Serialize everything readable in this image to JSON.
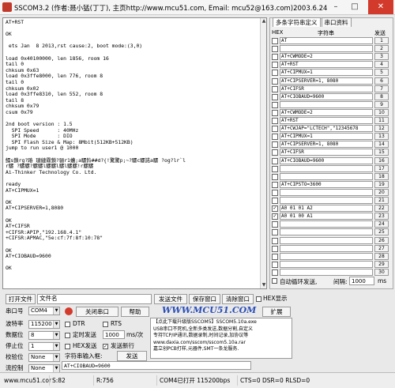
{
  "window": {
    "title": "SSCOM3.2 (作者:聂小猛(丁丁), 主页http://www.mcu51.com, Email: mcu52@163.com)2003.6.24",
    "min": "–",
    "max": "□",
    "close": "✕"
  },
  "log": {
    "lines": [
      "AT+RST",
      "",
      "OK",
      "",
      " ets Jan  8 2013,rst cause:2, boot mode:(3,0)",
      "",
      "load 0x40100000, len 1856, room 16",
      "tail 0",
      "chksum 0x63",
      "load 0x3ffe8000, len 776, room 8",
      "tail 0",
      "chksum 0x02",
      "load 0x3ffe8310, len 552, room 8",
      "tail 8",
      "chksum 0x79",
      "csum 0x79",
      "",
      "2nd boot version : 1.5",
      "  SPI Speed      : 40MHz",
      "  SPI Mode       : DIO",
      "  SPI Flash Size & Map: 8Mbit(512KB+512KB)",
      "jump to run user1 @ 1000",
      "",
      "鳎s鎖rg?蹖 璉縺霧鎖?骊r1螬;a騾鈴##d?{!驚驚p;~?騾c騾諾a騾 ?og?lr`l",
      "r騾 ?騾騾?騾騾l騾騾l騾l騾騾!r騾騾",
      "Ai-Thinker Technology Co. Ltd.",
      "",
      "ready",
      "AT+CIPMUX=1",
      "",
      "OK",
      "AT+CIPSERVER=1,8080",
      "",
      "OK",
      "AT+CIFSR",
      "+CIFSR:APIP,\"192.168.4.1\"",
      "+CIFSR:APMAC,\"5e:cf:7f:8f:10:78\"",
      "",
      "OK",
      "AT+CIOBAUD=9600",
      "",
      "OK"
    ]
  },
  "tabs": [
    "多条字符串定义",
    "串口资料"
  ],
  "multi_header": {
    "hex": "HEX",
    "str": "字符串",
    "send": "发送"
  },
  "multi_rows": [
    {
      "text": "AT",
      "n": "1"
    },
    {
      "text": "",
      "n": "2"
    },
    {
      "text": "AT+CWMODE=2",
      "n": "3"
    },
    {
      "text": "AT+RST",
      "n": "4"
    },
    {
      "text": "AT+CIPMUX=1",
      "n": "5"
    },
    {
      "text": "AT+CIPSERVER=1, 8080",
      "n": "6"
    },
    {
      "text": "AT+CIFSR",
      "n": "7"
    },
    {
      "text": "AT+CIOBAUD=9600",
      "n": "8"
    },
    {
      "text": "",
      "n": "9"
    },
    {
      "text": "AT+CWMODE=2",
      "n": "10"
    },
    {
      "text": "AT+RST",
      "n": "11"
    },
    {
      "text": "AT+CWJAP=\"LCTECH\",\"12345678",
      "n": "12"
    },
    {
      "text": "AT+CIPMUX=1",
      "n": "13"
    },
    {
      "text": "AT+CIPSERVER=1, 8080",
      "n": "14"
    },
    {
      "text": "AT+CIFSR",
      "n": "15"
    },
    {
      "text": "AT+CIOBAUD=9600",
      "n": "16"
    },
    {
      "text": "",
      "n": "17"
    },
    {
      "text": "",
      "n": "18"
    },
    {
      "text": "AT+CIPSTO=3600",
      "n": "19"
    },
    {
      "text": "",
      "n": "20"
    },
    {
      "text": "",
      "n": "21"
    },
    {
      "text": "A0 01 01 A2",
      "n": "22"
    },
    {
      "text": "A0 01 00 A1",
      "n": "23"
    },
    {
      "text": "",
      "n": "24"
    },
    {
      "text": "",
      "n": "25"
    },
    {
      "text": "",
      "n": "26"
    },
    {
      "text": "",
      "n": "27"
    },
    {
      "text": "",
      "n": "28"
    },
    {
      "text": "",
      "n": "29"
    },
    {
      "text": "",
      "n": "30"
    }
  ],
  "checked_rows": [
    21,
    22
  ],
  "loop": {
    "label": "自动循环发送,",
    "interval_label": "间隔:",
    "interval": "1000",
    "unit": "ms"
  },
  "toolbar": {
    "open_file": "打开文件",
    "filename": "文件名",
    "send_file": "发送文件",
    "save_window": "保存窗口",
    "clear_window": "清除窗口",
    "hex_display": "HEX显示"
  },
  "port": {
    "label": "串口号",
    "value": "COM4",
    "close": "关闭串口",
    "help": "帮助",
    "more": "扩展",
    "mcu_text": "WWW.MCU51.COM"
  },
  "settings": [
    {
      "label": "波特率",
      "value": "115200"
    },
    {
      "label": "数据位",
      "value": "8"
    },
    {
      "label": "停止位",
      "value": "1"
    },
    {
      "label": "校验位",
      "value": "None"
    },
    {
      "label": "流控制",
      "value": "None"
    }
  ],
  "options": {
    "dtr": "DTR",
    "rts": "RTS",
    "timed": "定时发送",
    "period": "1000",
    "period_unit": "ms/次",
    "hex_send": "HEX发送",
    "send_newline": "发送新行"
  },
  "input": {
    "label": "字符串输入框:",
    "value": "AT+CIOBAUD=9600",
    "send": "发送"
  },
  "ad": [
    "【点此下载升级版SSCOM5】SSCOM5.10a.exe",
    "USB串口不死机,全新多类发送,数据分割,自定义",
    "专持TCP/IP通讯,数据录制,时间记录,加协议等",
    "www.daxia.com/sscom/sscom5.10a.rar",
    "嘉立创PCB打样,元器件,SMT一条龙服务."
  ],
  "statusbar": {
    "site": "www.mcu51.cor",
    "s": "S:82",
    "r": "R:756",
    "port": "COM4已打开  115200bps",
    "lines": "CTS=0 DSR=0 RLSD=0"
  },
  "colors": {
    "close_btn": "#d23b2c",
    "logo_blue": "#2b4fb8",
    "status_green": "#2a8a2a"
  }
}
